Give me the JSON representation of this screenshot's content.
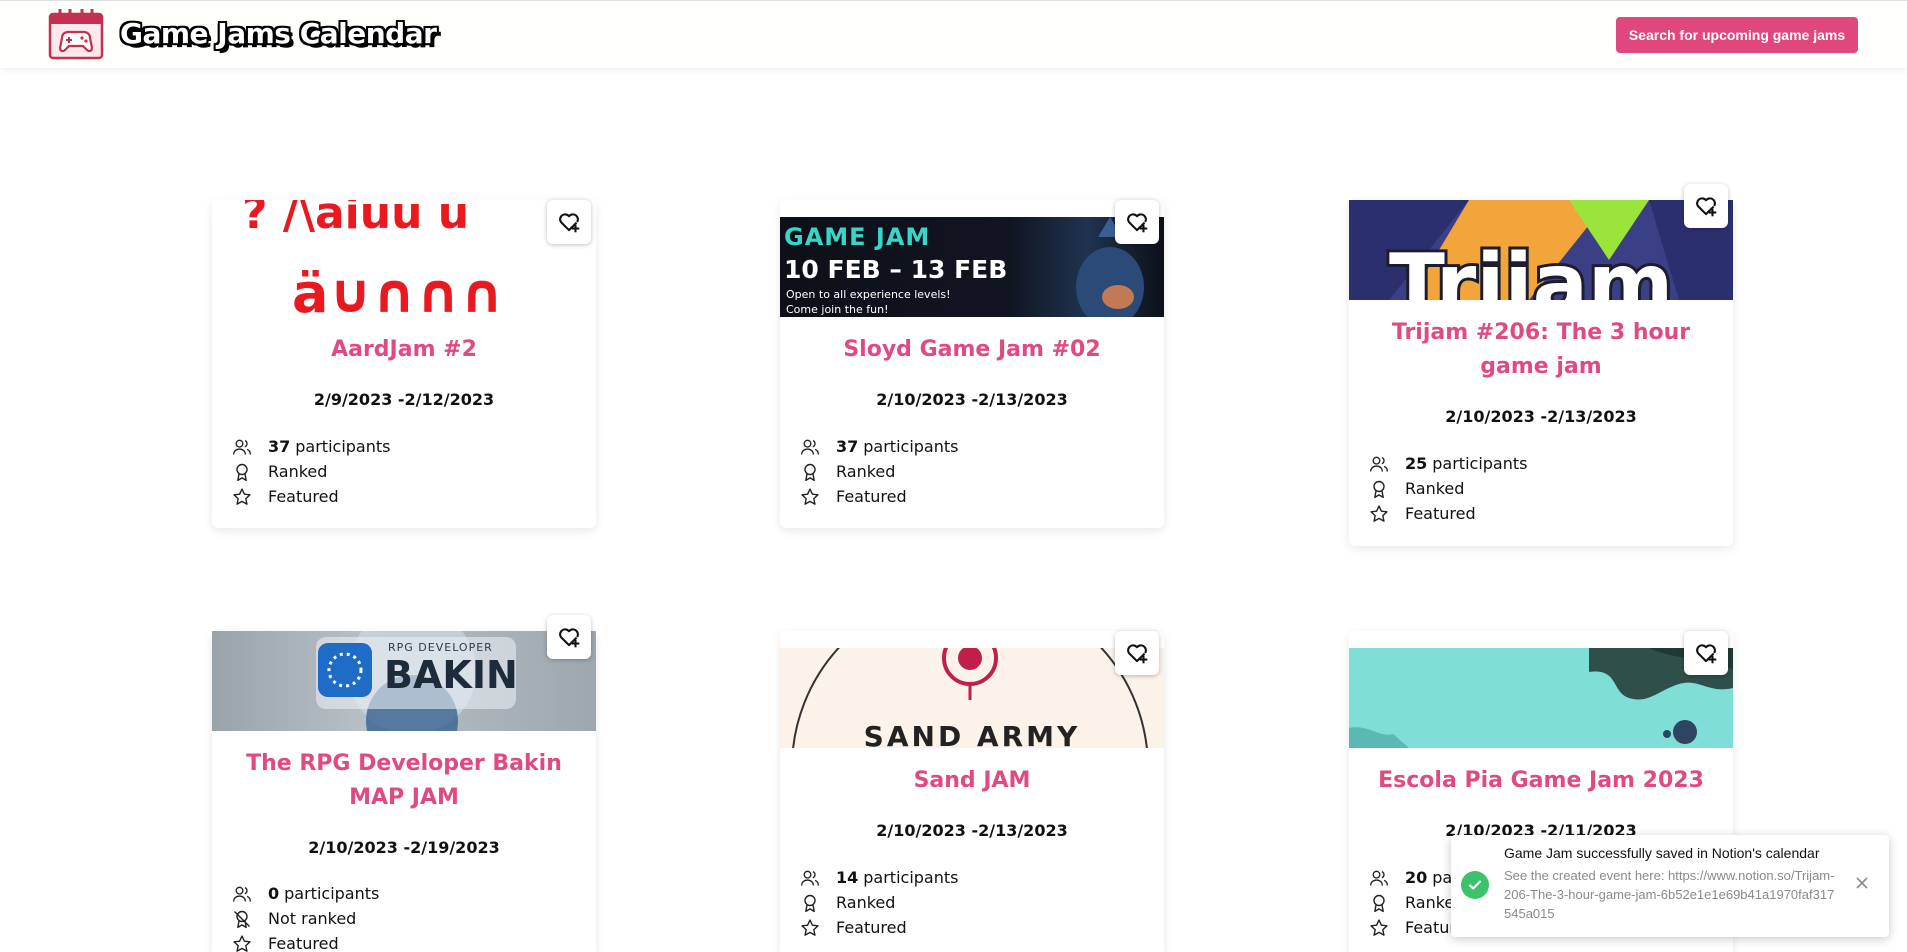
{
  "header": {
    "brand": "Game Jams Calendar",
    "search_button": "Search for upcoming game jams"
  },
  "cards": [
    {
      "title": "AardJam #2",
      "dates": "2/9/2023 -2/12/2023",
      "participants": "37",
      "participants_label": "participants",
      "ranked": "Ranked",
      "featured": "Featured"
    },
    {
      "title": "Sloyd Game Jam #02",
      "dates": "2/10/2023 -2/13/2023",
      "participants": "37",
      "participants_label": "participants",
      "ranked": "Ranked",
      "featured": "Featured",
      "banner_line1": "GAME JAM",
      "banner_line2": "10 FEB – 13 FEB",
      "banner_line3": "Open to all experience levels!",
      "banner_line4": "Come join the fun!"
    },
    {
      "title": "Trijam #206: The 3 hour game jam",
      "dates": "2/10/2023 -2/13/2023",
      "participants": "25",
      "participants_label": "participants",
      "ranked": "Ranked",
      "featured": "Featured"
    },
    {
      "title": "The RPG Developer Bakin MAP JAM",
      "dates": "2/10/2023 -2/19/2023",
      "participants": "0",
      "participants_label": "participants",
      "ranked": "Not ranked",
      "featured": "Featured",
      "banner_line1": "RPG DEVELOPER",
      "banner_line2": "BAKIN"
    },
    {
      "title": "Sand JAM",
      "dates": "2/10/2023 -2/13/2023",
      "participants": "14",
      "participants_label": "participants",
      "ranked": "Ranked",
      "featured": "Featured",
      "banner_line1": "SAND ARMY"
    },
    {
      "title": "Escola Pia Game Jam 2023",
      "dates": "2/10/2023 -2/11/2023",
      "participants": "20",
      "participants_label": "participants",
      "ranked": "Ranked",
      "featured": "Featured"
    }
  ],
  "toast": {
    "title": "Game Jam successfully saved in Notion's calendar",
    "body": "See the created event here: https://www.notion.so/Trijam-206-The-3-hour-game-jam-6b52e1e1e69b41a1970faf317545a015"
  },
  "colors": {
    "accent": "#e0477e",
    "title": "#df4a84",
    "success": "#3cc36a"
  }
}
